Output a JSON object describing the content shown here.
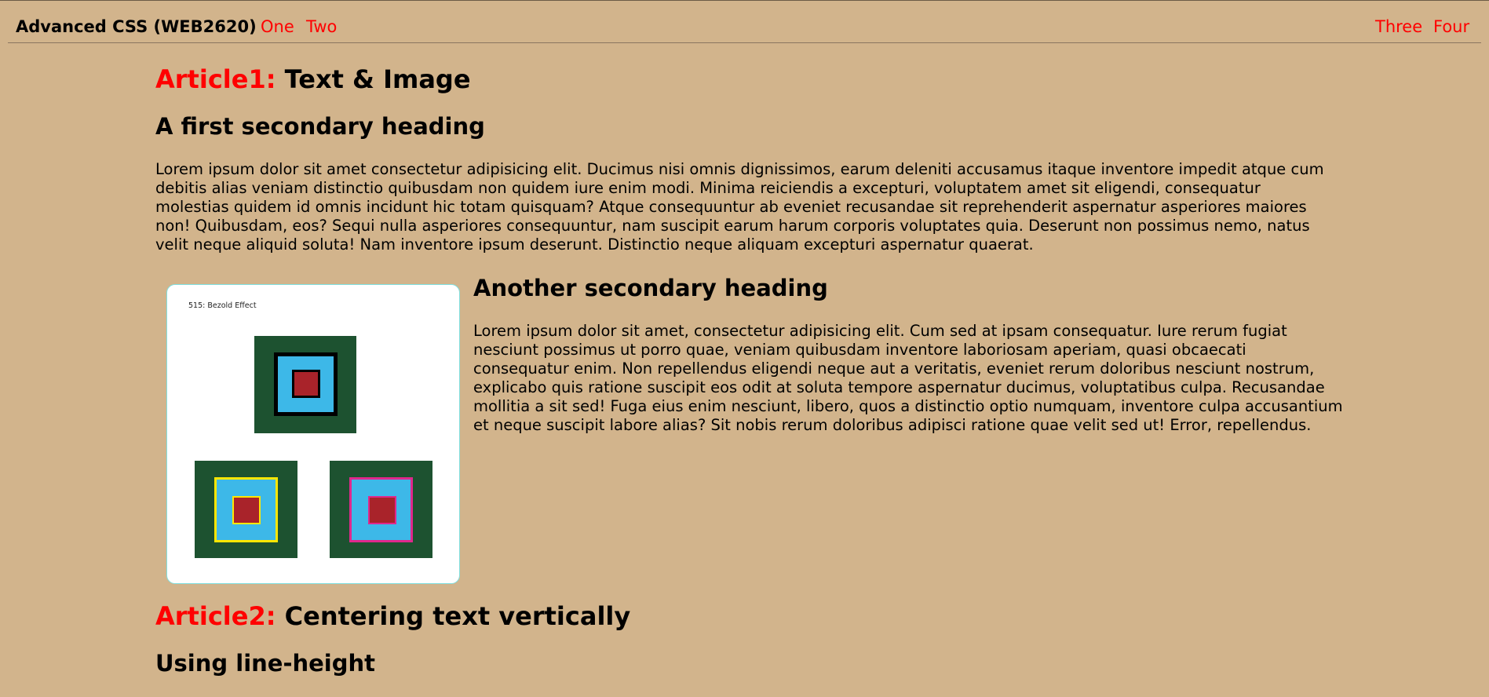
{
  "nav": {
    "brand": "Advanced CSS (WEB2620)",
    "left_links": [
      "One",
      "Two"
    ],
    "right_links": [
      "Three",
      "Four"
    ]
  },
  "article1": {
    "label": "Article1:",
    "title": " Text & Image",
    "heading1": "A first secondary heading",
    "paragraph1": "Lorem ipsum dolor sit amet consectetur adipisicing elit. Ducimus nisi omnis dignissimos, earum deleniti accusamus itaque inventore impedit atque cum debitis alias veniam distinctio quibusdam non quidem iure enim modi. Minima reiciendis a excepturi, voluptatem amet sit eligendi, consequatur molestias quidem id omnis incidunt hic totam quisquam? Atque consequuntur ab eveniet recusandae sit reprehenderit aspernatur asperiores maiores non! Quibusdam, eos? Sequi nulla asperiores consequuntur, nam suscipit earum harum corporis voluptates quia. Deserunt non possimus nemo, natus velit neque aliquid soluta! Nam inventore ipsum deserunt. Distinctio neque aliquam excepturi aspernatur quaerat.",
    "figure_caption": "515: Bezold Effect",
    "heading2": "Another secondary heading",
    "paragraph2": "Lorem ipsum dolor sit amet, consectetur adipisicing elit. Cum sed at ipsam consequatur. Iure rerum fugiat nesciunt possimus ut porro quae, veniam quibusdam inventore laboriosam aperiam, quasi obcaecati consequatur enim. Non repellendus eligendi neque aut a veritatis, eveniet rerum doloribus nesciunt nostrum, explicabo quis ratione suscipit eos odit at soluta tempore aspernatur ducimus, voluptatibus culpa. Recusandae mollitia a sit sed! Fuga eius enim nesciunt, libero, quos a distinctio optio numquam, inventore culpa accusantium et neque suscipit labore alias? Sit nobis rerum doloribus adipisci ratione quae velit sed ut! Error, repellendus."
  },
  "article2": {
    "label": "Article2:",
    "title": " Centering text vertically",
    "heading1": "Using line-height"
  },
  "colors": {
    "background": "#d2b48c",
    "accent": "#ff0000",
    "square_outer": "#1d5230",
    "square_mid": "#3db8e8",
    "square_inner": "#a9232a",
    "ring_black": "#000000",
    "ring_yellow": "#ffe600",
    "ring_magenta": "#e0288c"
  }
}
